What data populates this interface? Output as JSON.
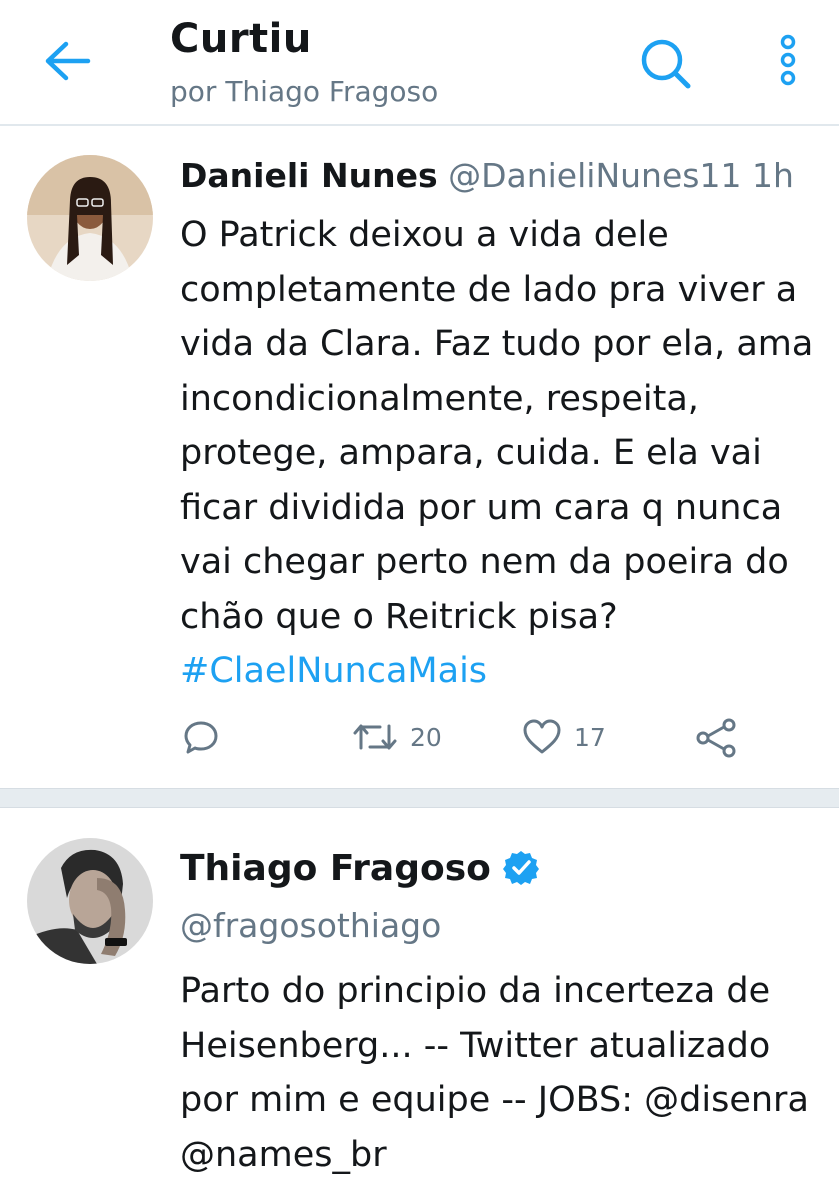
{
  "header": {
    "title": "Curtiu",
    "subtitle": "por Thiago Fragoso",
    "back_icon": "back-arrow-icon",
    "search_icon": "search-icon",
    "more_icon": "more-vertical-icon"
  },
  "tweet": {
    "author_name": "Danieli Nunes",
    "author_handle": "@DanieliNunes11",
    "time": "1h",
    "text": "O Patrick deixou a vida dele completamente de lado pra viver a vida da Clara. Faz tudo por ela, ama incondicionalmente, respeita, protege, ampara, cuida. E ela vai ficar dividida por um cara q  nunca vai chegar perto nem da poeira do chão que o Reitrick pisa?",
    "hashtag": "#ClaelNuncaMais",
    "retweets": "20",
    "likes": "17"
  },
  "profile": {
    "name": "Thiago Fragoso",
    "handle": "@fragosothiago",
    "bio": "Parto do principio da incerteza de Heisenberg... -- Twitter atualizado por mim e equipe -- JOBS: @disenra @names_br",
    "verified": true
  },
  "colors": {
    "accent": "#1da1f2",
    "text": "#14171a",
    "muted": "#657786",
    "divider": "#e6ecf0"
  }
}
